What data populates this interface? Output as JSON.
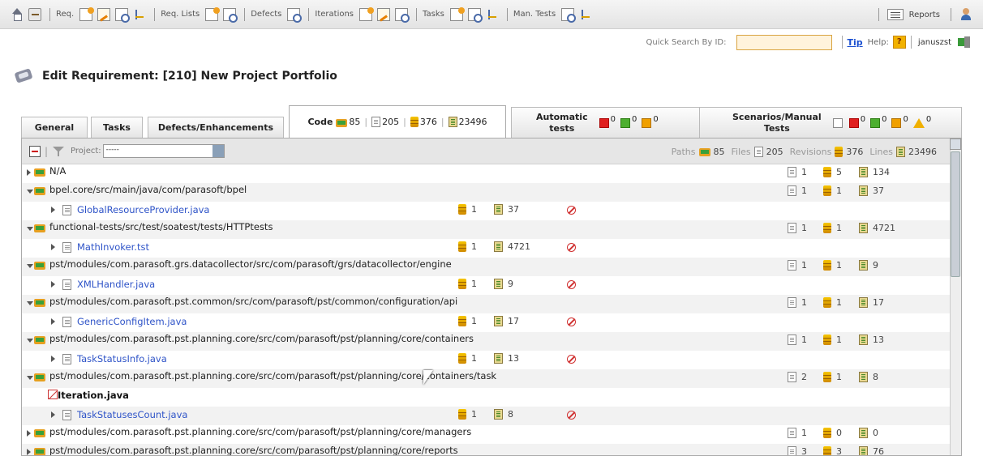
{
  "toolbar": {
    "groups": [
      {
        "label": "Req.",
        "icons": [
          "add-icon",
          "edit-icon",
          "search-icon",
          "tree-icon"
        ]
      },
      {
        "label": "Req. Lists",
        "icons": [
          "add-icon",
          "search-icon"
        ]
      },
      {
        "label": "Defects",
        "icons": [
          "search-icon"
        ]
      },
      {
        "label": "Iterations",
        "icons": [
          "add-icon",
          "edit-icon",
          "search-icon"
        ]
      },
      {
        "label": "Tasks",
        "icons": [
          "add-icon",
          "search-icon",
          "tree-icon"
        ]
      },
      {
        "label": "Man. Tests",
        "icons": [
          "search-icon",
          "tree-icon"
        ]
      }
    ],
    "reports_label": "Reports"
  },
  "searchbar": {
    "quick_search_label": "Quick Search By ID:",
    "quick_search_value": "",
    "tip_label": "Tip",
    "help_label": "Help:",
    "help_button": "?",
    "username": "januszst"
  },
  "page": {
    "title": "Edit Requirement: [210] New Project Portfolio"
  },
  "tabs": {
    "general": "General",
    "tasks": "Tasks",
    "defects": "Defects/Enhancements",
    "code": {
      "label": "Code",
      "paths": "85",
      "files": "205",
      "revisions": "376",
      "lines": "23496"
    },
    "automatic": {
      "label_line1": "Automatic",
      "label_line2": "tests",
      "failed": "0",
      "passed": "0",
      "incomplete": "0"
    },
    "scenarios": {
      "label_line1": "Scenarios/Manual",
      "label_line2": "Tests",
      "not_run": "",
      "failed": "0",
      "passed": "0",
      "incomplete": "0",
      "warning": "0"
    }
  },
  "panel": {
    "project_label": "Project:",
    "project_value": "-----",
    "summary": {
      "paths_label": "Paths",
      "paths": "85",
      "files_label": "Files",
      "files": "205",
      "revisions_label": "Revisions",
      "revisions": "376",
      "lines_label": "Lines",
      "lines": "23496"
    }
  },
  "tree_rows": [
    {
      "kind": "path",
      "expanded": false,
      "text": "N/A",
      "files": "1",
      "revisions": "5",
      "lines": "134"
    },
    {
      "kind": "path",
      "expanded": true,
      "text": "bpel.core/src/main/java/com/parasoft/bpel",
      "files": "1",
      "revisions": "1",
      "lines": "37"
    },
    {
      "kind": "file",
      "text": "GlobalResourceProvider.java",
      "revisions": "1",
      "lines": "37"
    },
    {
      "kind": "path",
      "expanded": true,
      "text": "functional-tests/src/test/soatest/tests/HTTPtests",
      "files": "1",
      "revisions": "1",
      "lines": "4721"
    },
    {
      "kind": "file",
      "text": "MathInvoker.tst",
      "revisions": "1",
      "lines": "4721"
    },
    {
      "kind": "path",
      "expanded": true,
      "text": "pst/modules/com.parasoft.grs.datacollector/src/com/parasoft/grs/datacollector/engine",
      "files": "1",
      "revisions": "1",
      "lines": "9"
    },
    {
      "kind": "file",
      "text": "XMLHandler.java",
      "revisions": "1",
      "lines": "9"
    },
    {
      "kind": "path",
      "expanded": true,
      "text": "pst/modules/com.parasoft.pst.common/src/com/parasoft/pst/common/configuration/api",
      "files": "1",
      "revisions": "1",
      "lines": "17"
    },
    {
      "kind": "file",
      "text": "GenericConfigItem.java",
      "revisions": "1",
      "lines": "17"
    },
    {
      "kind": "path",
      "expanded": true,
      "text": "pst/modules/com.parasoft.pst.planning.core/src/com/parasoft/pst/planning/core/containers",
      "files": "1",
      "revisions": "1",
      "lines": "13"
    },
    {
      "kind": "file",
      "text": "TaskStatusInfo.java",
      "revisions": "1",
      "lines": "13"
    },
    {
      "kind": "path",
      "expanded": true,
      "text": "pst/modules/com.parasoft.pst.planning.core/src/com/parasoft/pst/planning/core/containers/task",
      "files": "2",
      "revisions": "1",
      "lines": "8"
    },
    {
      "kind": "broken",
      "text": "Iteration.java"
    },
    {
      "kind": "file",
      "text": "TaskStatusesCount.java",
      "revisions": "1",
      "lines": "8"
    },
    {
      "kind": "path",
      "expanded": false,
      "text": "pst/modules/com.parasoft.pst.planning.core/src/com/parasoft/pst/planning/core/managers",
      "files": "1",
      "revisions": "0",
      "lines": "0"
    },
    {
      "kind": "path",
      "expanded": false,
      "text": "pst/modules/com.parasoft.pst.planning.core/src/com/parasoft/pst/planning/core/reports",
      "files": "3",
      "revisions": "3",
      "lines": "76"
    }
  ]
}
